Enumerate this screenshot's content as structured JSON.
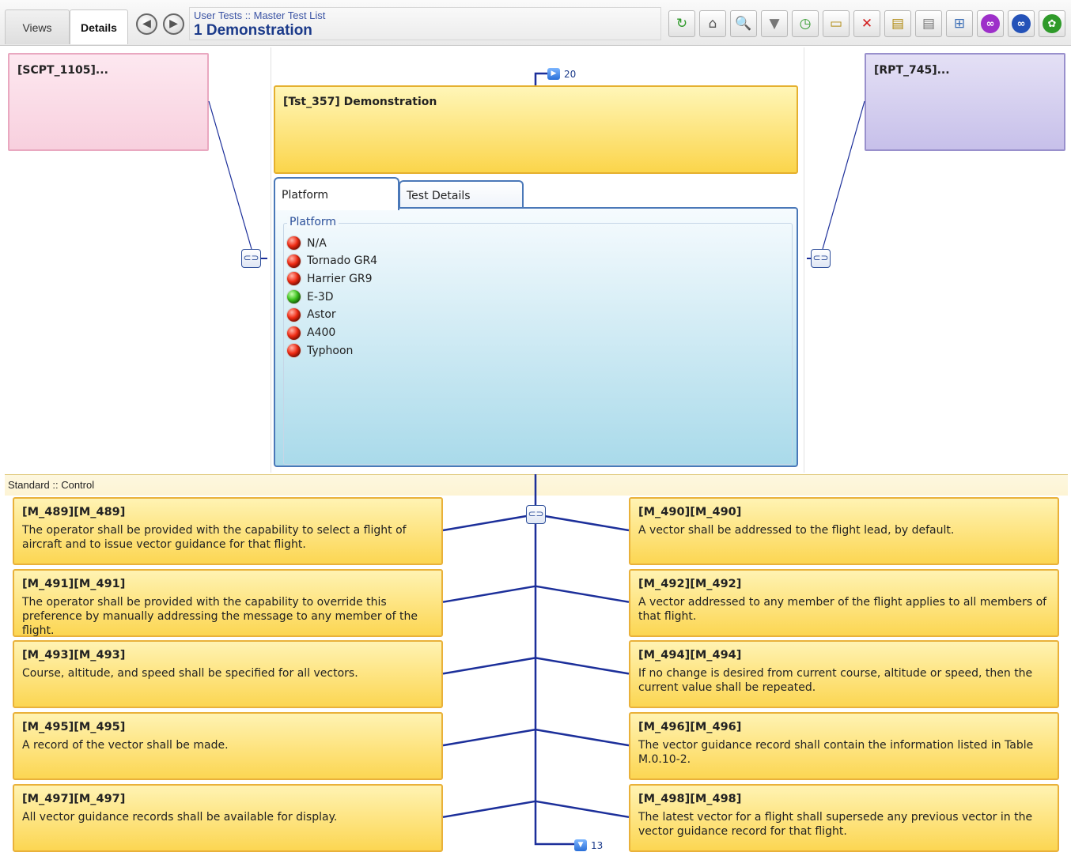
{
  "views_tabs": {
    "views": "Views",
    "details": "Details"
  },
  "nav": {
    "back_icon": "arrow-left-icon",
    "forward_icon": "arrow-right-icon"
  },
  "breadcrumb": "User Tests :: Master Test List",
  "page_title": "1 Demonstration",
  "toolbar": [
    {
      "name": "refresh-icon",
      "glyph": "↻",
      "color": "#2f9a2a"
    },
    {
      "name": "home-icon",
      "glyph": "⌂",
      "color": "#555555"
    },
    {
      "name": "search-icon",
      "glyph": "🔍",
      "color": "#555555"
    },
    {
      "name": "filter-icon",
      "glyph": "▼",
      "color": "#777777"
    },
    {
      "name": "history-icon",
      "glyph": "◷",
      "color": "#2f9a2a"
    },
    {
      "name": "new-item-icon",
      "glyph": "▭",
      "color": "#b08a10"
    },
    {
      "name": "delete-icon",
      "glyph": "✕",
      "color": "#d21c1c"
    },
    {
      "name": "document-export-icon",
      "glyph": "▤",
      "color": "#b08a10"
    },
    {
      "name": "document-icon",
      "glyph": "▤",
      "color": "#777777"
    },
    {
      "name": "hierarchy-icon",
      "glyph": "⊞",
      "color": "#3a6db5"
    },
    {
      "name": "link-purple-icon",
      "glyph": "∞",
      "color": "#9d2fc9"
    },
    {
      "name": "link-blue-icon",
      "glyph": "∞",
      "color": "#2452b8"
    },
    {
      "name": "settings-icon",
      "glyph": "✿",
      "color": "#2f9a2a"
    }
  ],
  "cards": {
    "scpt": "[SCPT_1105]...",
    "rpt": "[RPT_745]...",
    "main": "[Tst_357] Demonstration"
  },
  "counts": {
    "top": "20",
    "bottom": "13"
  },
  "detail_tabs": {
    "platform": "Platform",
    "test_details": "Test Details"
  },
  "platform": {
    "legend": "Platform",
    "items": [
      {
        "label": "N/A",
        "status": "red"
      },
      {
        "label": "Tornado GR4",
        "status": "red"
      },
      {
        "label": "Harrier GR9",
        "status": "red"
      },
      {
        "label": "E-3D",
        "status": "green"
      },
      {
        "label": "Astor",
        "status": "red"
      },
      {
        "label": "A400",
        "status": "red"
      },
      {
        "label": "Typhoon",
        "status": "red"
      }
    ]
  },
  "bottom_header": "Standard :: Control",
  "requirements": [
    {
      "title": "[M_489][M_489]",
      "text": "The operator shall be provided with the capability to select a flight of aircraft and to issue vector guidance for that flight."
    },
    {
      "title": "[M_490][M_490]",
      "text": "A vector shall be addressed to the flight lead, by default."
    },
    {
      "title": "[M_491][M_491]",
      "text": "The operator shall be provided with the capability to override this preference by manually addressing the message to any member of the flight."
    },
    {
      "title": "[M_492][M_492]",
      "text": "A vector addressed to any member of the flight applies to all members of that flight."
    },
    {
      "title": "[M_493][M_493]",
      "text": "Course, altitude, and speed shall be specified for all vectors."
    },
    {
      "title": "[M_494][M_494]",
      "text": "If no change is desired from current course, altitude or speed, then the current value shall be repeated."
    },
    {
      "title": "[M_495][M_495]",
      "text": "A record of the vector shall be made."
    },
    {
      "title": "[M_496][M_496]",
      "text": "The vector guidance record shall contain the information listed in Table M.0.10-2."
    },
    {
      "title": "[M_497][M_497]",
      "text": "All vector guidance records shall be available for display."
    },
    {
      "title": "[M_498][M_498]",
      "text": "The latest vector for a flight shall supersede any previous vector in the vector guidance record for that flight."
    }
  ]
}
